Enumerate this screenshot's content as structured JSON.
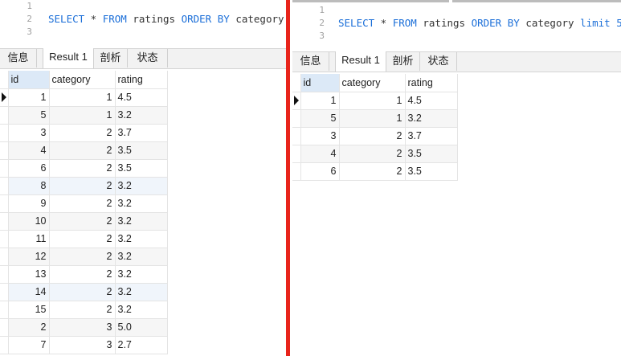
{
  "left": {
    "line_numbers": [
      "1",
      "2",
      "3"
    ],
    "sql": {
      "k1": "SELECT",
      "t1": " * ",
      "k2": "FROM",
      "t2": " ratings ",
      "k3": "ORDER BY",
      "t3": " category;"
    },
    "tabs": [
      "信息",
      "Result 1",
      "剖析",
      "状态"
    ],
    "active_tab": "Result 1",
    "columns": [
      "id",
      "category",
      "rating"
    ],
    "rows": [
      [
        "1",
        "1",
        "4.5"
      ],
      [
        "5",
        "1",
        "3.2"
      ],
      [
        "3",
        "2",
        "3.7"
      ],
      [
        "4",
        "2",
        "3.5"
      ],
      [
        "6",
        "2",
        "3.5"
      ],
      [
        "8",
        "2",
        "3.2"
      ],
      [
        "9",
        "2",
        "3.2"
      ],
      [
        "10",
        "2",
        "3.2"
      ],
      [
        "11",
        "2",
        "3.2"
      ],
      [
        "12",
        "2",
        "3.2"
      ],
      [
        "13",
        "2",
        "3.2"
      ],
      [
        "14",
        "2",
        "3.2"
      ],
      [
        "15",
        "2",
        "3.2"
      ],
      [
        "2",
        "3",
        "5.0"
      ],
      [
        "7",
        "3",
        "2.7"
      ]
    ]
  },
  "right": {
    "line_numbers": [
      "1",
      "2",
      "3"
    ],
    "sql": {
      "k1": "SELECT",
      "t1": " * ",
      "k2": "FROM",
      "t2": " ratings ",
      "k3": "ORDER BY",
      "t3": " category ",
      "k4": "limit",
      "t4": " ",
      "n1": "5",
      "t5": ";"
    },
    "tabs": [
      "信息",
      "Result 1",
      "剖析",
      "状态"
    ],
    "active_tab": "Result 1",
    "columns": [
      "id",
      "category",
      "rating"
    ],
    "rows": [
      [
        "1",
        "1",
        "4.5"
      ],
      [
        "5",
        "1",
        "3.2"
      ],
      [
        "3",
        "2",
        "3.7"
      ],
      [
        "4",
        "2",
        "3.5"
      ],
      [
        "6",
        "2",
        "3.5"
      ]
    ]
  },
  "colors": {
    "divider": "#e8241b",
    "keyword": "#1a6ed8",
    "header_selected": "#dce9f7"
  },
  "icons": {
    "current_row_indicator": "triangle-right-icon"
  }
}
